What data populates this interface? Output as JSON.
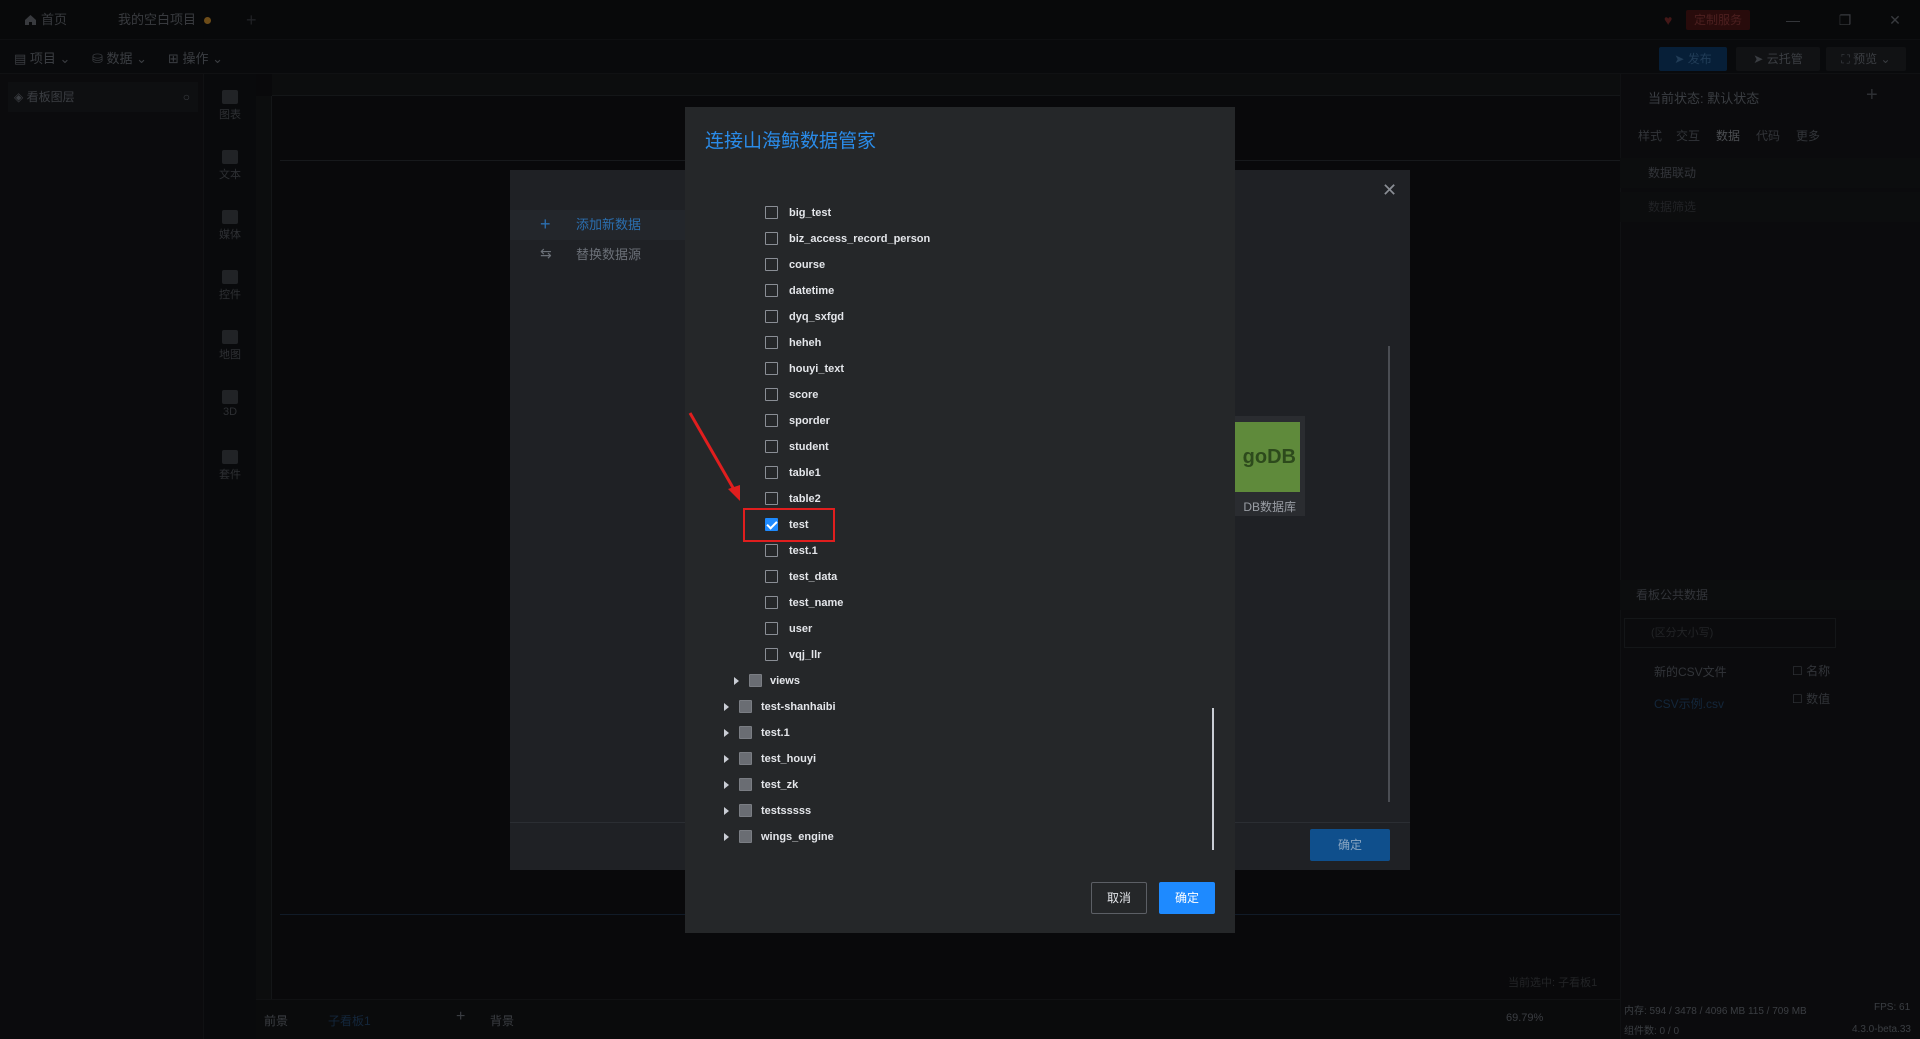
{
  "titlebar": {
    "home": "首页",
    "project": "我的空白项目",
    "custom_service": "定制服务"
  },
  "menubar": {
    "project": "项目",
    "data": "数据",
    "operate": "操作",
    "publish": "发布",
    "cloud": "云托管",
    "preview": "预览"
  },
  "layer_panel": {
    "title": "看板图层"
  },
  "rail": [
    "图表",
    "文本",
    "媒体",
    "控件",
    "地图",
    "3D",
    "套件"
  ],
  "canvas": {
    "note": "当前选中: 子看板1"
  },
  "bottom": {
    "front": "前景",
    "child": "子看板1",
    "background": "背景",
    "zoom": "69.79%"
  },
  "right_panel": {
    "state": "当前状态: 默认状态",
    "tabs": [
      "样式",
      "交互",
      "数据",
      "代码",
      "更多"
    ],
    "data_link": "数据联动",
    "data_filter": "数据筛选",
    "public_data": "看板公共数据",
    "search_placeholder": "(区分大小写)",
    "csv": "新的CSV文件",
    "csv_file": "CSV示例.csv",
    "field_name": "名称",
    "field_value": "数值",
    "status1": "内存: 594 / 3478 / 4096 MB  115 / 709 MB",
    "status2": "组件数: 0 / 0",
    "fps": "FPS: 61",
    "version": "4.3.0-beta.33"
  },
  "bg_dialog": {
    "add": "添加新数据",
    "replace": "替换数据源",
    "card_logo": "goDB",
    "card_label": "DB数据库",
    "confirm": "确定"
  },
  "modal": {
    "title": "连接山海鲸数据管家",
    "tables": [
      {
        "label": "big_test",
        "checked": false
      },
      {
        "label": "biz_access_record_person",
        "checked": false
      },
      {
        "label": "course",
        "checked": false
      },
      {
        "label": "datetime",
        "checked": false
      },
      {
        "label": "dyq_sxfgd",
        "checked": false
      },
      {
        "label": "heheh",
        "checked": false
      },
      {
        "label": "houyi_text",
        "checked": false
      },
      {
        "label": "score",
        "checked": false
      },
      {
        "label": "sporder",
        "checked": false
      },
      {
        "label": "student",
        "checked": false
      },
      {
        "label": "table1",
        "checked": false
      },
      {
        "label": "table2",
        "checked": false
      },
      {
        "label": "test",
        "checked": true
      },
      {
        "label": "test.1",
        "checked": false
      },
      {
        "label": "test_data",
        "checked": false
      },
      {
        "label": "test_name",
        "checked": false
      },
      {
        "label": "user",
        "checked": false
      },
      {
        "label": "vqj_llr",
        "checked": false
      }
    ],
    "views": "views",
    "databases": [
      "test-shanhaibi",
      "test.1",
      "test_houyi",
      "test_zk",
      "testsssss",
      "wings_engine"
    ],
    "cancel": "取消",
    "ok": "确定"
  }
}
